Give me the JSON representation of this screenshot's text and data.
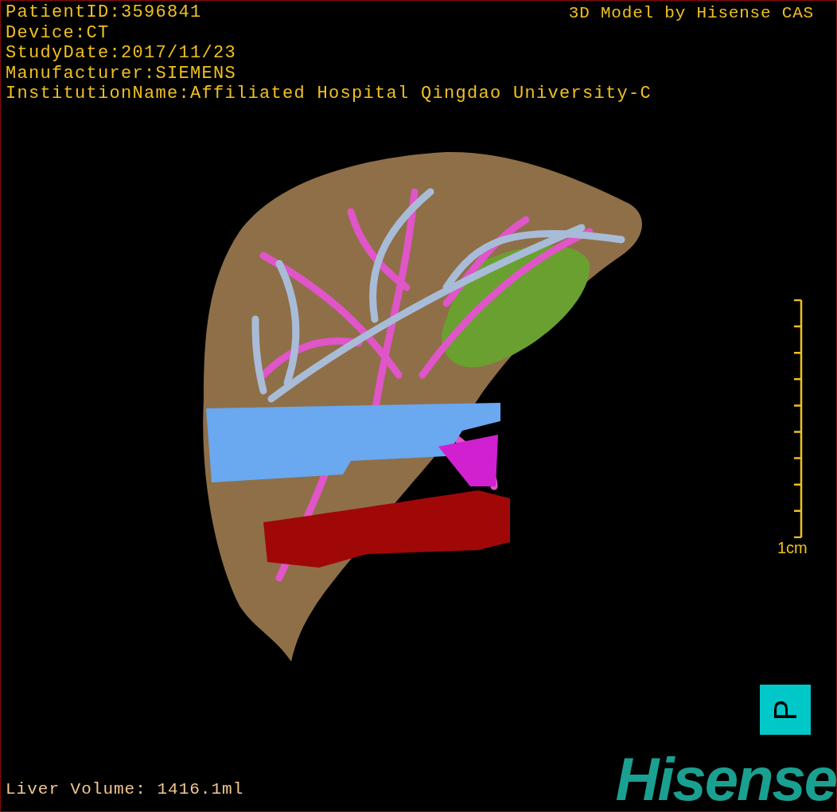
{
  "info_lines": [
    "PatientID:3596841",
    "Device:CT",
    "StudyDate:2017/11/23",
    "Manufacturer:SIEMENS",
    "InstitutionName:Affiliated Hospital Qingdao University-C"
  ],
  "credit": "3D Model by Hisense CAS",
  "scale_bar": {
    "label": "1cm"
  },
  "orientation_marker": {
    "label": "P"
  },
  "liver_volume": "Liver Volume: 1416.1ml",
  "logo": "Hisense"
}
